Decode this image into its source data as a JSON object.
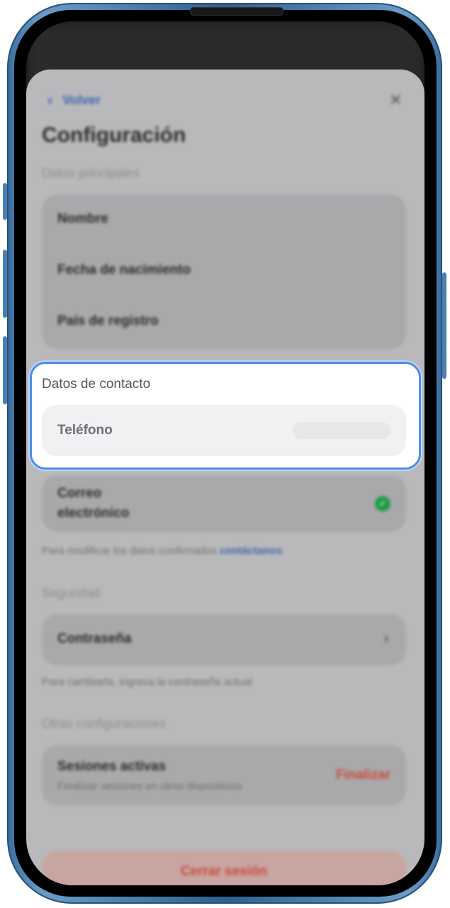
{
  "header": {
    "back_label": "Volver"
  },
  "page": {
    "title": "Configuración"
  },
  "main_data": {
    "section_title": "Datos principales",
    "rows": [
      "Nombre",
      "Fecha de nacimiento",
      "País de registro"
    ]
  },
  "contact": {
    "section_title": "Datos de contacto",
    "phone_label": "Teléfono",
    "email_label_line1": "Correo",
    "email_label_line2": "electrónico",
    "note": "Para modificar los datos confirmados",
    "note_link": "contáctanos"
  },
  "security": {
    "section_title": "Seguridad",
    "password_label": "Contraseña",
    "note": "Para cambiarla, ingresa la contraseña actual"
  },
  "other": {
    "section_title": "Otras configuraciones",
    "sessions_title": "Sesiones activas",
    "sessions_subtitle": "Finalizar sesiones en otros dispositivos",
    "sessions_action": "Finalizar"
  },
  "logout_label": "Cerrar sesión",
  "colors": {
    "accent": "#3e63b0",
    "danger": "#c94a3c",
    "success": "#1f9b46",
    "highlight": "#4d8ee8"
  }
}
